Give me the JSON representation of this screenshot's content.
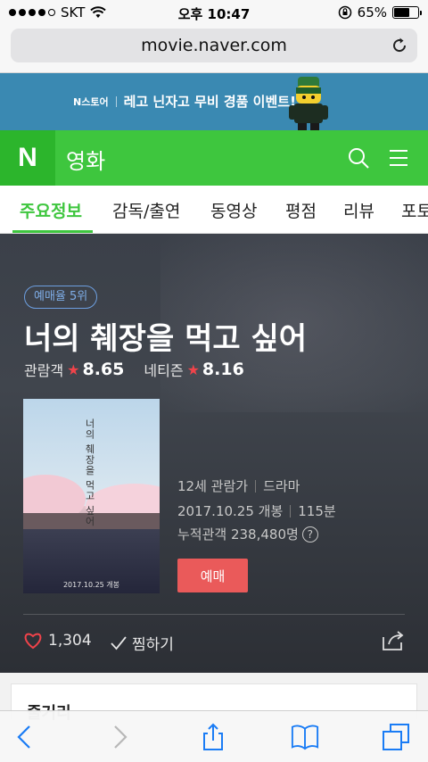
{
  "status_bar": {
    "carrier": "SKT",
    "time": "오후 10:47",
    "battery": "65%",
    "battery_level": 0.65
  },
  "browser": {
    "url": "movie.naver.com"
  },
  "banner": {
    "brand": "N스토어",
    "text": "레고 닌자고 무비 경품 이벤트!"
  },
  "header": {
    "logo": "N",
    "section": "영화"
  },
  "tabs": [
    {
      "label": "주요정보",
      "active": true
    },
    {
      "label": "감독/출연"
    },
    {
      "label": "동영상"
    },
    {
      "label": "평점"
    },
    {
      "label": "리뷰"
    },
    {
      "label": "포토"
    }
  ],
  "movie": {
    "rank_badge": "예매율 5위",
    "title": "너의 췌장을 먹고 싶어",
    "audience_label": "관람객",
    "audience_score": "8.65",
    "netizen_label": "네티즌",
    "netizen_score": "8.16",
    "poster_title": "너의 췌장을 먹고 싶어",
    "rating": "12세 관람가",
    "genre": "드라마",
    "release": "2017.10.25 개봉",
    "runtime": "115분",
    "cumulative": "누적관객 238,480명",
    "help": "?",
    "reserve_label": "예매",
    "likes": "1,304",
    "wish_label": "찜하기"
  },
  "plot": {
    "title": "줄거리"
  },
  "colors": {
    "naver_green": "#3ec63e",
    "reserve_red": "#ea5a5a",
    "star_red": "#f0434a",
    "banner_blue": "#3a89b2"
  }
}
